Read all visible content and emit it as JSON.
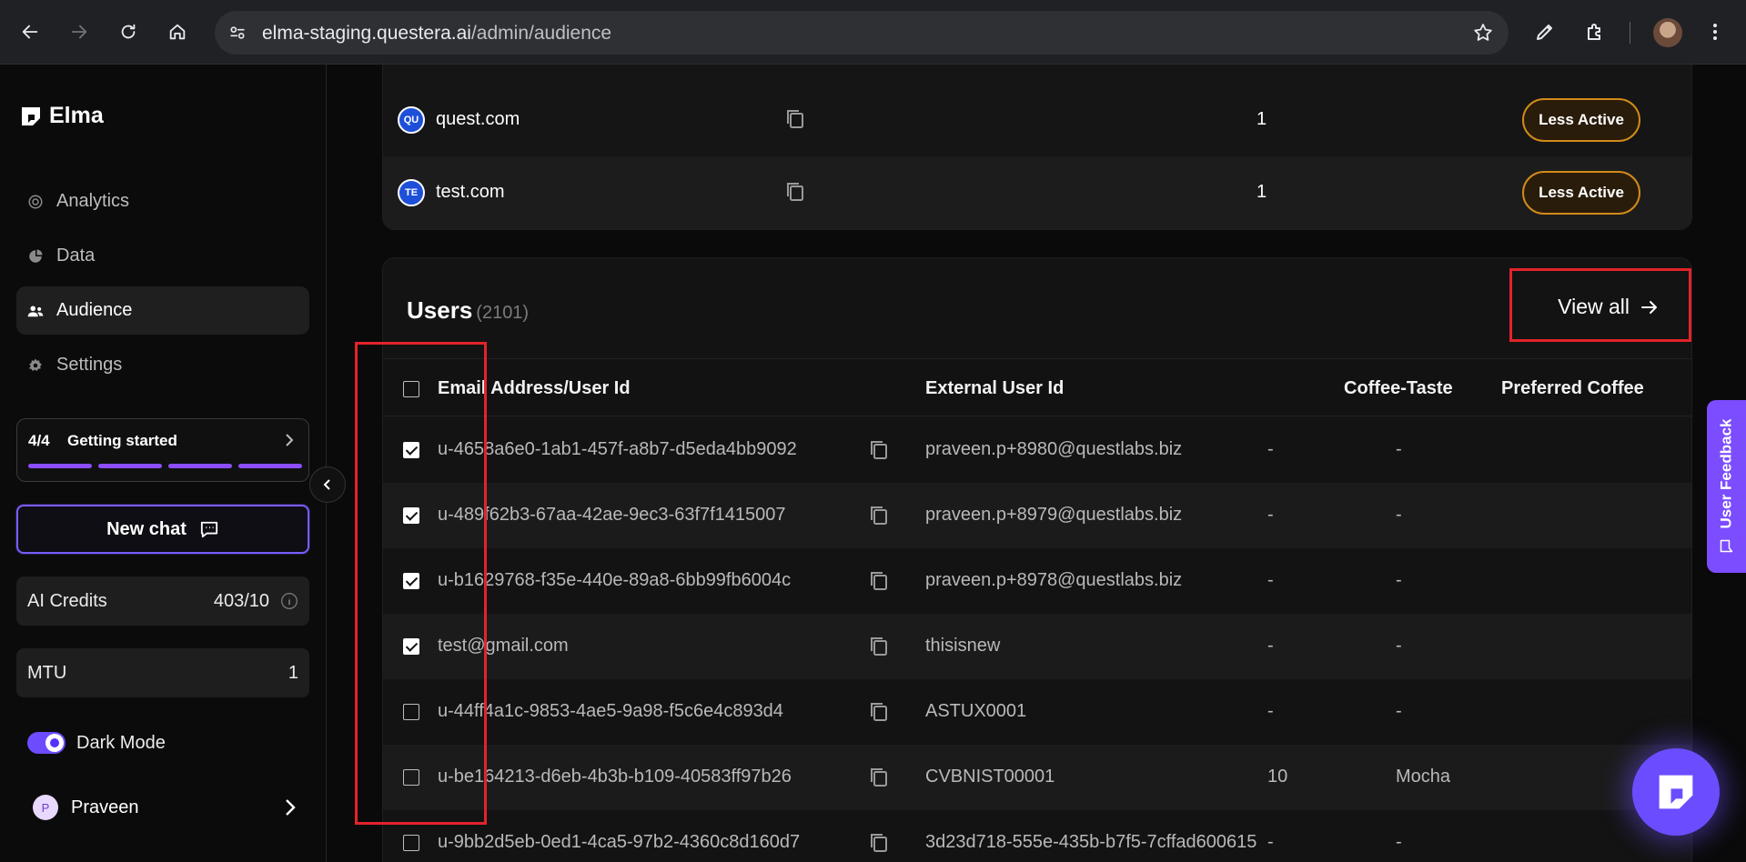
{
  "browser": {
    "url_host": "elma-staging.questera.ai",
    "url_path": "/admin/audience"
  },
  "sidebar": {
    "logo_text": "Elma",
    "nav": [
      {
        "label": "Analytics",
        "icon": "analytics-icon",
        "active": false
      },
      {
        "label": "Data",
        "icon": "pie-chart-icon",
        "active": false
      },
      {
        "label": "Audience",
        "icon": "users-icon",
        "active": true
      },
      {
        "label": "Settings",
        "icon": "gear-icon",
        "active": false
      }
    ],
    "getting_started": {
      "count": "4/4",
      "title": "Getting started",
      "steps_completed": 4,
      "steps_total": 4
    },
    "new_chat_label": "New chat",
    "ai_credits": {
      "label": "AI Credits",
      "value": "403/10"
    },
    "mtu": {
      "label": "MTU",
      "value": "1"
    },
    "dark_mode": {
      "label": "Dark Mode",
      "enabled": true
    },
    "user": {
      "initial": "P",
      "name": "Praveen"
    }
  },
  "companies": [
    {
      "badge": "QU",
      "name": "quest.com",
      "count": "1",
      "status": "Less Active"
    },
    {
      "badge": "TE",
      "name": "test.com",
      "count": "1",
      "status": "Less Active"
    }
  ],
  "users": {
    "title": "Users",
    "count": "(2101)",
    "view_all_label": "View all",
    "columns": [
      "Email Address/User Id",
      "External User Id",
      "Coffee-Taste",
      "Preferred Coffee"
    ],
    "rows": [
      {
        "checked": true,
        "id": "u-4658a6e0-1ab1-457f-a8b7-d5eda4bb9092",
        "external": "praveen.p+8980@questlabs.biz",
        "coffee_taste": "-",
        "preferred_coffee": "-"
      },
      {
        "checked": true,
        "id": "u-489f62b3-67aa-42ae-9ec3-63f7f1415007",
        "external": "praveen.p+8979@questlabs.biz",
        "coffee_taste": "-",
        "preferred_coffee": "-"
      },
      {
        "checked": true,
        "id": "u-b1629768-f35e-440e-89a8-6bb99fb6004c",
        "external": "praveen.p+8978@questlabs.biz",
        "coffee_taste": "-",
        "preferred_coffee": "-"
      },
      {
        "checked": true,
        "id": "test@gmail.com",
        "external": "thisisnew",
        "coffee_taste": "-",
        "preferred_coffee": "-"
      },
      {
        "checked": false,
        "id": "u-44ff4a1c-9853-4ae5-9a98-f5c6e4c893d4",
        "external": "ASTUX0001",
        "coffee_taste": "-",
        "preferred_coffee": "-"
      },
      {
        "checked": false,
        "id": "u-be164213-d6eb-4b3b-b109-40583ff97b26",
        "external": "CVBNIST00001",
        "coffee_taste": "10",
        "preferred_coffee": "Mocha"
      },
      {
        "checked": false,
        "id": "u-9bb2d5eb-0ed1-4ca5-97b2-4360c8d160d7",
        "external": "3d23d718-555e-435b-b7f5-7cffad600615",
        "coffee_taste": "-",
        "preferred_coffee": "-"
      }
    ]
  },
  "feedback_tab_label": "User Feedback",
  "colors": {
    "accent": "#7b4dff",
    "pill_border": "#d28a1a",
    "annotation": "#e3232b"
  }
}
